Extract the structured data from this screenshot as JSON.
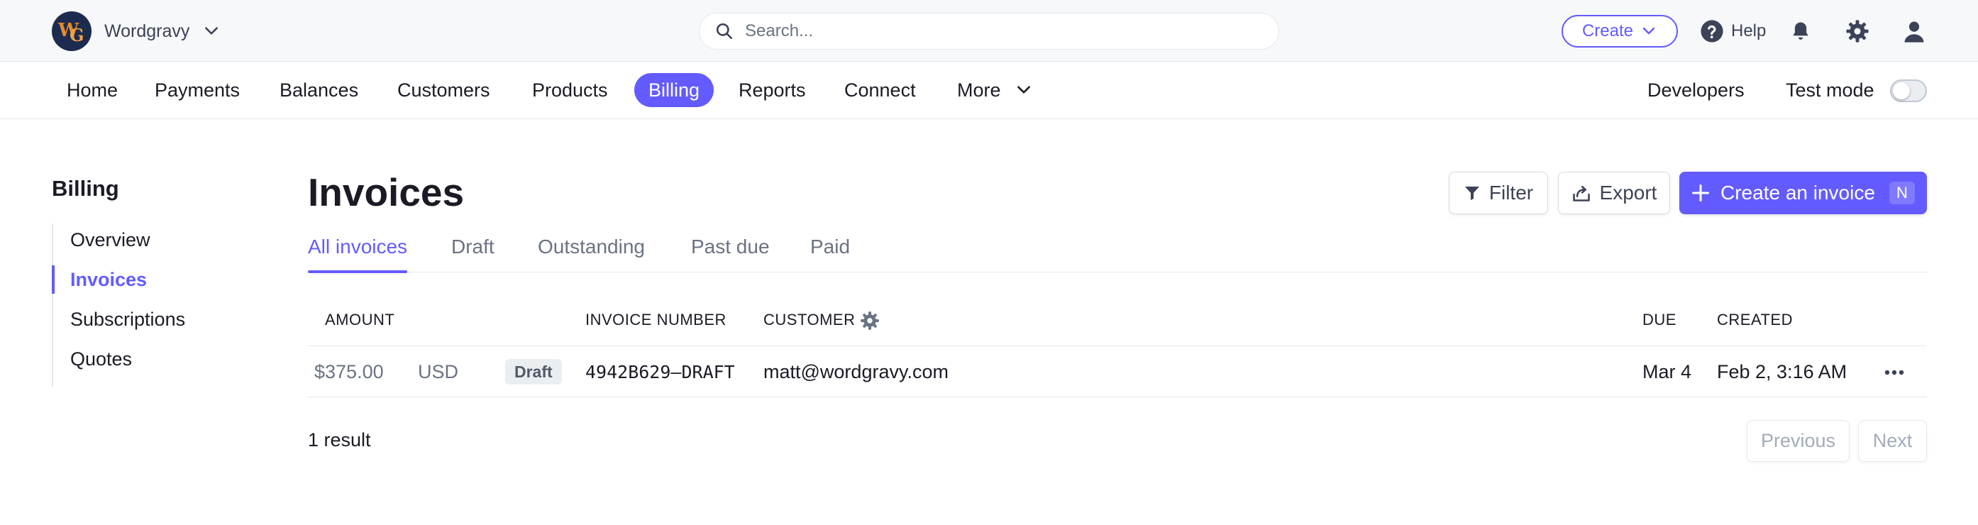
{
  "colors": {
    "accent": "#635bff",
    "text": "#1a1b25",
    "muted": "#6a7383",
    "border": "#e3e8ee",
    "topbar_bg": "#f6f8fa"
  },
  "topbar": {
    "account_logo": "WG",
    "account_name": "Wordgravy",
    "search_placeholder": "Search...",
    "create_label": "Create",
    "help_label": "Help",
    "icons": [
      "search-icon",
      "chevron-down-icon",
      "help-icon",
      "bell-icon",
      "gear-icon",
      "user-icon"
    ]
  },
  "nav": {
    "items": [
      {
        "label": "Home"
      },
      {
        "label": "Payments"
      },
      {
        "label": "Balances"
      },
      {
        "label": "Customers"
      },
      {
        "label": "Products"
      },
      {
        "label": "Billing",
        "active": true
      },
      {
        "label": "Reports"
      },
      {
        "label": "Connect"
      },
      {
        "label": "More"
      }
    ],
    "developers_label": "Developers",
    "test_mode_label": "Test mode",
    "test_mode_on": false
  },
  "sidebar": {
    "title": "Billing",
    "items": [
      {
        "label": "Overview"
      },
      {
        "label": "Invoices",
        "active": true
      },
      {
        "label": "Subscriptions"
      },
      {
        "label": "Quotes"
      }
    ]
  },
  "page": {
    "title": "Invoices",
    "filter_label": "Filter",
    "export_label": "Export",
    "create_invoice_label": "Create an invoice",
    "create_invoice_shortcut": "N",
    "tabs": [
      {
        "label": "All invoices",
        "active": true
      },
      {
        "label": "Draft"
      },
      {
        "label": "Outstanding"
      },
      {
        "label": "Past due"
      },
      {
        "label": "Paid"
      }
    ]
  },
  "table": {
    "columns": {
      "amount": "AMOUNT",
      "invoice_number": "INVOICE NUMBER",
      "customer": "CUSTOMER",
      "due": "DUE",
      "created": "CREATED"
    },
    "rows": [
      {
        "amount": "$375.00",
        "currency": "USD",
        "status": "Draft",
        "invoice_number": "4942B629–DRAFT",
        "customer": "matt@wordgravy.com",
        "due": "Mar 4",
        "created": "Feb 2, 3:16 AM"
      }
    ]
  },
  "footer": {
    "result_count": "1 result",
    "previous_label": "Previous",
    "next_label": "Next"
  }
}
